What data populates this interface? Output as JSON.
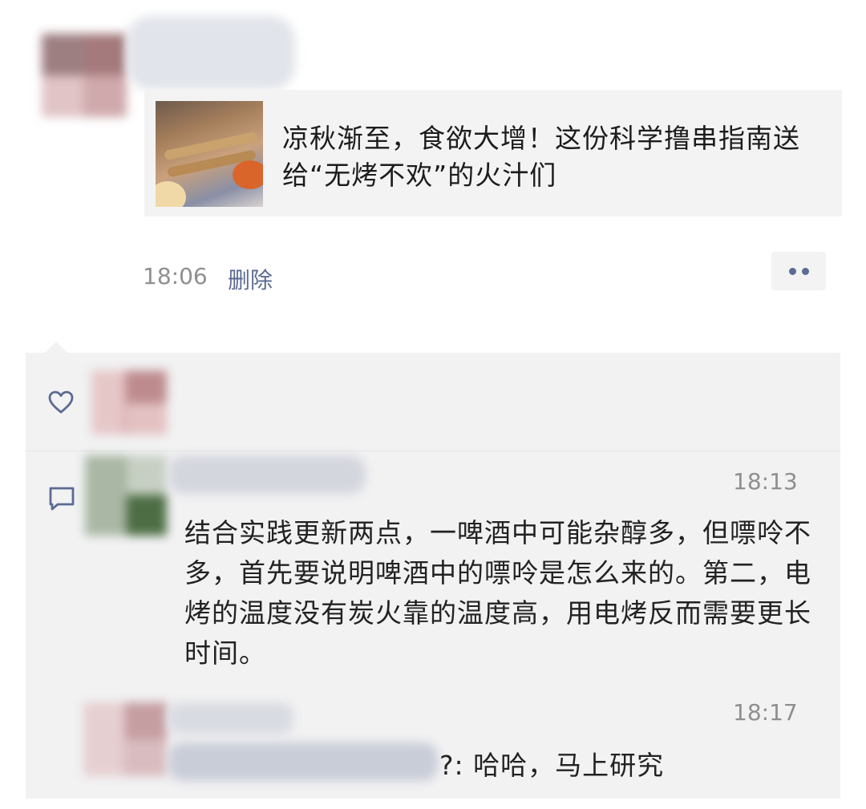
{
  "post": {
    "shared_article_title": "凉秋渐至，食欲大增！这份科学撸串指南送给“无烤不欢”的火汁们",
    "time": "18:06",
    "delete_label": "删除"
  },
  "comments": [
    {
      "time": "18:13",
      "text": "结合实践更新两点，一啤酒中可能杂醇多，但嘌呤不多，首先要说明啤酒中的嘌呤是怎么来的。第二，电烤的温度没有炭火靠的温度高，用电烤反而需要更长时间。"
    },
    {
      "time": "18:17",
      "text": "?: 哈哈，马上研究"
    }
  ],
  "icons": {
    "like": "heart-icon",
    "comment": "comment-icon",
    "more": "more-dots-icon"
  },
  "colors": {
    "link": "#5b6b92",
    "timestamp": "#8f8f8f",
    "panel": "#f2f2f3"
  }
}
